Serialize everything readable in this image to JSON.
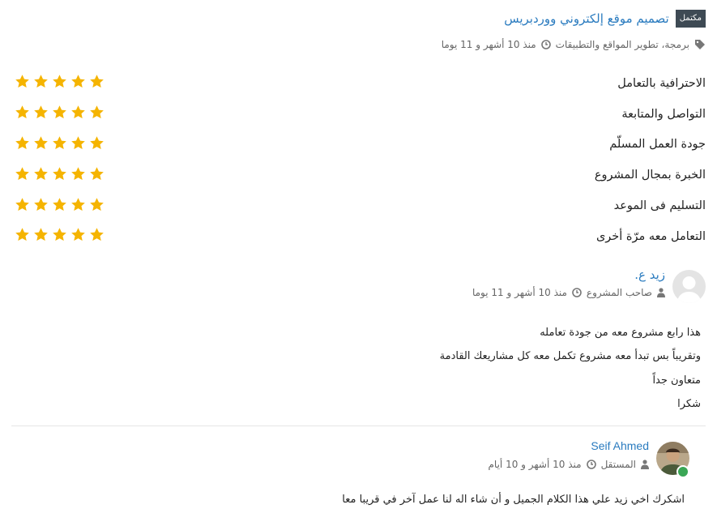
{
  "project": {
    "badge": "مكتمل",
    "title": "تصميم موقع إلكتروني ووردبريس",
    "category": "برمجة، تطوير المواقع والتطبيقات",
    "time": "منذ 10 أشهر و 11 يوما"
  },
  "ratings": [
    {
      "label": "الاحترافية بالتعامل",
      "stars": 5
    },
    {
      "label": "التواصل والمتابعة",
      "stars": 5
    },
    {
      "label": "جودة العمل المسلّم",
      "stars": 5
    },
    {
      "label": "الخبرة بمجال المشروع",
      "stars": 5
    },
    {
      "label": "التسليم فى الموعد",
      "stars": 5
    },
    {
      "label": "التعامل معه مرّة أخرى",
      "stars": 5
    }
  ],
  "review": {
    "name": "زيد ع.",
    "role": "صاحب المشروع",
    "time": "منذ 10 أشهر و 11 يوما",
    "lines": [
      "هذا رابع مشروع معه من جودة تعامله",
      "وتقريباً بس تبدأ معه مشروع تكمل معه كل مشاريعك القادمة",
      "متعاون جداً",
      "شكرا"
    ]
  },
  "reply": {
    "name": "Seif Ahmed",
    "role": "المستقل",
    "time": "منذ 10 أشهر و 10 أيام",
    "text": "اشكرك اخي زيد علي هذا الكلام الجميل و أن شاء اله لنا عمل آخر في قريبا معا"
  },
  "colors": {
    "star": "#f5b400",
    "link": "#2a7bbf",
    "badge": "#3e4a54",
    "online": "#3aa655"
  }
}
